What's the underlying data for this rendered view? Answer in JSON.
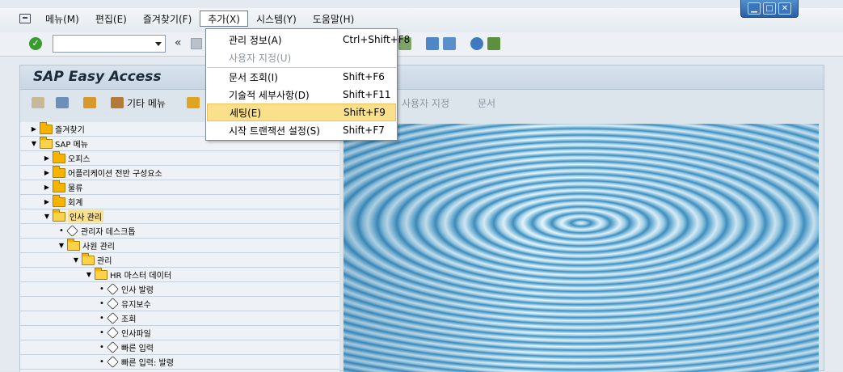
{
  "menubar": {
    "items": [
      "메뉴(M)",
      "편집(E)",
      "즐겨찾기(F)",
      "추가(X)",
      "시스템(Y)",
      "도움말(H)"
    ]
  },
  "window_controls": {
    "minimize": "▁",
    "maximize": "□",
    "close": "✕"
  },
  "toolbar": {
    "command_value": "",
    "double_arrow": "«"
  },
  "dropdown": {
    "items": [
      {
        "label": "관리 정보(A)",
        "shortcut": "Ctrl+Shift+F8"
      },
      {
        "label": "사용자 지정(U)",
        "shortcut": ""
      },
      {
        "label": "문서 조회(I)",
        "shortcut": "Shift+F6"
      },
      {
        "label": "기술적 세부사항(D)",
        "shortcut": "Shift+F11"
      },
      {
        "label": "세팅(E)",
        "shortcut": "Shift+F9"
      },
      {
        "label": "시작 트랜잭션 설정(S)",
        "shortcut": "Shift+F7"
      }
    ]
  },
  "content": {
    "title": "SAP Easy Access",
    "toolbar": {
      "other_menu": "기타 메뉴",
      "user_settings": "사용자 지정",
      "document": "문서"
    }
  },
  "tree": {
    "rows": [
      {
        "label": "즐겨찾기",
        "type": "folder"
      },
      {
        "label": "SAP 메뉴",
        "type": "folder-open"
      },
      {
        "label": "오피스",
        "type": "folder"
      },
      {
        "label": "어플리케이션 전반 구성요소",
        "type": "folder"
      },
      {
        "label": "물류",
        "type": "folder"
      },
      {
        "label": "회계",
        "type": "folder"
      },
      {
        "label": "인사 관리",
        "type": "folder-open"
      },
      {
        "label": "관리자 데스크톱",
        "type": "transaction"
      },
      {
        "label": "사원 관리",
        "type": "folder-open"
      },
      {
        "label": "관리",
        "type": "folder-open"
      },
      {
        "label": "HR 마스터 데이터",
        "type": "folder-open"
      },
      {
        "label": "인사 발령",
        "type": "transaction"
      },
      {
        "label": "유지보수",
        "type": "transaction"
      },
      {
        "label": "조회",
        "type": "transaction"
      },
      {
        "label": "인사파일",
        "type": "transaction"
      },
      {
        "label": "빠른 입력",
        "type": "transaction"
      },
      {
        "label": "빠른 입력: 발령",
        "type": "transaction"
      }
    ]
  }
}
